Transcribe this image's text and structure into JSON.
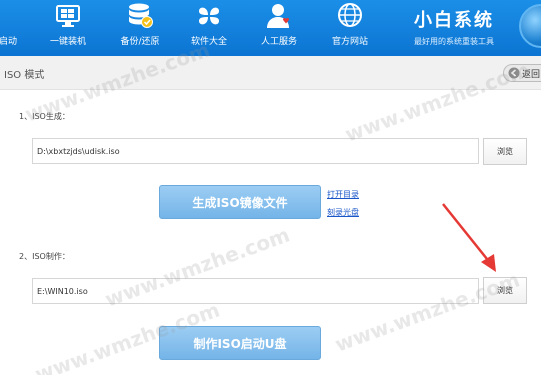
{
  "nav": {
    "items": [
      {
        "label": "启动",
        "icon": "rocket-icon"
      },
      {
        "label": "一键装机",
        "icon": "monitor-windows-icon"
      },
      {
        "label": "备份/还原",
        "icon": "database-icon"
      },
      {
        "label": "软件大全",
        "icon": "clover-icon"
      },
      {
        "label": "人工服务",
        "icon": "support-person-icon"
      },
      {
        "label": "官方网站",
        "icon": "globe-icon"
      }
    ],
    "brand_title": "小白系统",
    "brand_slogan": "最好用的系统重装工具"
  },
  "subheader": {
    "breadcrumb": "ISO 模式",
    "back_label": "返回"
  },
  "iso_generate": {
    "section_label": "1、ISO生成：",
    "path_value": "D:\\xbxtzjds\\udisk.iso",
    "browse_label": "浏览",
    "action_label": "生成ISO镜像文件",
    "open_dir_link": "打开目录",
    "burn_link": "刻录光盘"
  },
  "iso_make": {
    "section_label": "2、ISO制作：",
    "path_value": "E:\\WIN10.iso",
    "browse_label": "浏览",
    "action_label": "制作ISO启动U盘"
  },
  "watermark_text": "www.wmzhe.com",
  "colors": {
    "topbar": "#0c74d2",
    "primary_button": "#74b4e8",
    "link": "#1a56c8",
    "annotation_arrow": "#e53935"
  }
}
